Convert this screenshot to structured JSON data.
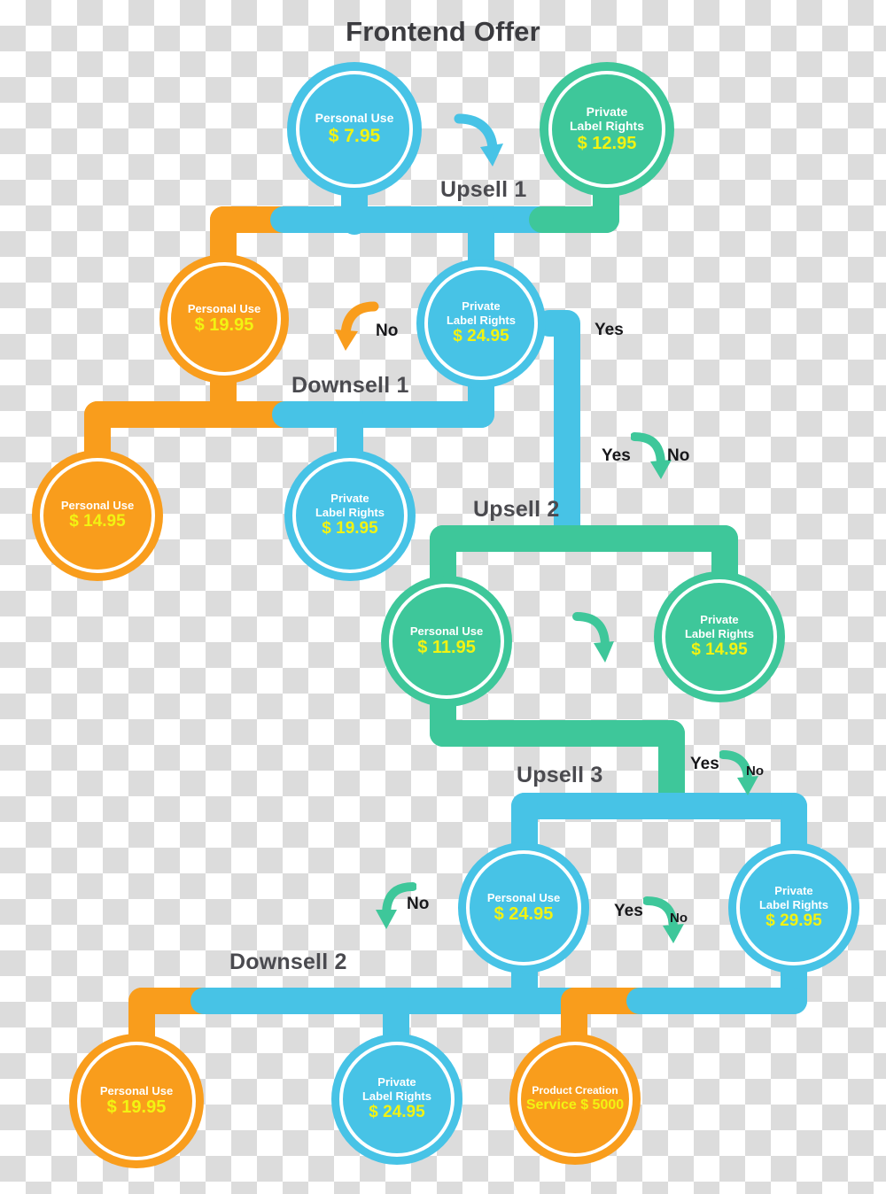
{
  "title": "Frontend Offer",
  "colors": {
    "blue": "#47c3e6",
    "green": "#3ec79a",
    "orange": "#f99d1c",
    "price": "#f2f312",
    "label": "#ffffff",
    "stage_text": "#4a4a4f"
  },
  "stages": [
    {
      "id": "upsell1",
      "label": "Upsell 1"
    },
    {
      "id": "downsell1",
      "label": "Downsell 1"
    },
    {
      "id": "upsell2",
      "label": "Upsell 2"
    },
    {
      "id": "upsell3",
      "label": "Upsell 3"
    },
    {
      "id": "downsell2",
      "label": "Downsell 2"
    }
  ],
  "nodes": [
    {
      "id": "fe-personal",
      "name": "Personal Use",
      "price": "$ 7.95",
      "color": "blue"
    },
    {
      "id": "fe-plr",
      "name": "Private\nLabel Rights",
      "price": "$ 12.95",
      "color": "green"
    },
    {
      "id": "u1-personal",
      "name": "Personal Use",
      "price": "$ 19.95",
      "color": "orange"
    },
    {
      "id": "u1-plr",
      "name": "Private\nLabel Rights",
      "price": "$ 24.95",
      "color": "blue"
    },
    {
      "id": "d1-personal",
      "name": "Personal Use",
      "price": "$ 14.95",
      "color": "orange"
    },
    {
      "id": "d1-plr",
      "name": "Private\nLabel Rights",
      "price": "$ 19.95",
      "color": "blue"
    },
    {
      "id": "u2-personal",
      "name": "Personal Use",
      "price": "$ 11.95",
      "color": "green"
    },
    {
      "id": "u2-plr",
      "name": "Private\nLabel Rights",
      "price": "$ 14.95",
      "color": "green"
    },
    {
      "id": "u3-personal",
      "name": "Personal Use",
      "price": "$ 24.95",
      "color": "blue"
    },
    {
      "id": "u3-plr",
      "name": "Private\nLabel Rights",
      "price": "$ 29.95",
      "color": "blue"
    },
    {
      "id": "d2-personal",
      "name": "Personal Use",
      "price": "$ 19.95",
      "color": "orange"
    },
    {
      "id": "d2-plr",
      "name": "Private\nLabel Rights",
      "price": "$ 24.95",
      "color": "blue"
    },
    {
      "id": "d2-service",
      "name": "Product Creation",
      "price": "Service $ 5000",
      "color": "orange"
    }
  ],
  "decisions": [
    {
      "id": "d-u1-no",
      "text": "No",
      "size": "normal"
    },
    {
      "id": "d-u1-yes",
      "text": "Yes",
      "size": "normal"
    },
    {
      "id": "d-u2-yes",
      "text": "Yes",
      "size": "normal"
    },
    {
      "id": "d-u2-no",
      "text": "No",
      "size": "normal"
    },
    {
      "id": "d-u3-yes",
      "text": "Yes",
      "size": "normal"
    },
    {
      "id": "d-u3-no",
      "text": "No",
      "size": "small"
    },
    {
      "id": "d-d2-no",
      "text": "No",
      "size": "normal"
    },
    {
      "id": "d-d2-yes",
      "text": "Yes",
      "size": "normal"
    },
    {
      "id": "d-d2-no2",
      "text": "No",
      "size": "small"
    }
  ]
}
